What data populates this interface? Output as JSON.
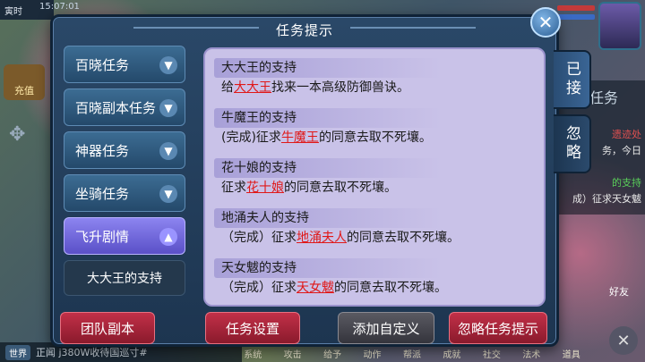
{
  "background": {
    "time_label": "寅时",
    "clock": "15:07:01",
    "charge_label": "充值",
    "task_word": "任务",
    "side_lines": [
      "遗迹处",
      "务，今日",
      "的支持",
      "成）征求天女魃"
    ],
    "chat_world": "世界",
    "chat_text": "正闻  j380W收待国巡寸#",
    "bottom_menu": [
      "系统",
      "攻击",
      "给予",
      "动作",
      "帮派",
      "成就",
      "社交",
      "法术"
    ],
    "friend_label": "好友",
    "items_label": "道具"
  },
  "dialog": {
    "title": "任务提示",
    "close_icon": "✕",
    "categories": [
      {
        "label": "百晓任务",
        "expanded": false
      },
      {
        "label": "百晓副本任务",
        "expanded": false
      },
      {
        "label": "神器任务",
        "expanded": false
      },
      {
        "label": "坐骑任务",
        "expanded": false
      },
      {
        "label": "飞升剧情",
        "expanded": true
      }
    ],
    "sub_item": "大大王的支持",
    "tasks": [
      {
        "title": "大大王的支持",
        "pre": "给",
        "highlight": "大大王",
        "post": "找来一本高级防御兽诀。"
      },
      {
        "title": "牛魔王的支持",
        "pre": "(完成)征求",
        "highlight": "牛魔王",
        "post": "的同意去取不死壤。"
      },
      {
        "title": "花十娘的支持",
        "pre": "征求",
        "highlight": "花十娘",
        "post": "的同意去取不死壤。"
      },
      {
        "title": "地涌夫人的支持",
        "pre": "（完成）征求",
        "highlight": "地涌夫人",
        "post": "的同意去取不死壤。"
      },
      {
        "title": "天女魃的支持",
        "pre": "（完成）征求",
        "highlight": "天女魃",
        "post": "的同意去取不死壤。"
      }
    ],
    "footer": {
      "team_dungeon": "团队副本",
      "task_settings": "任务设置",
      "add_custom": "添加自定义",
      "ignore_tips": "忽略任务提示"
    },
    "side_tabs": {
      "accepted": "已接",
      "ignored": "忽略"
    }
  },
  "colors": {
    "highlight": "#e01818",
    "panel": "#c9c2e8",
    "active_category": "#7a70e0",
    "red_button": "#a82238"
  }
}
